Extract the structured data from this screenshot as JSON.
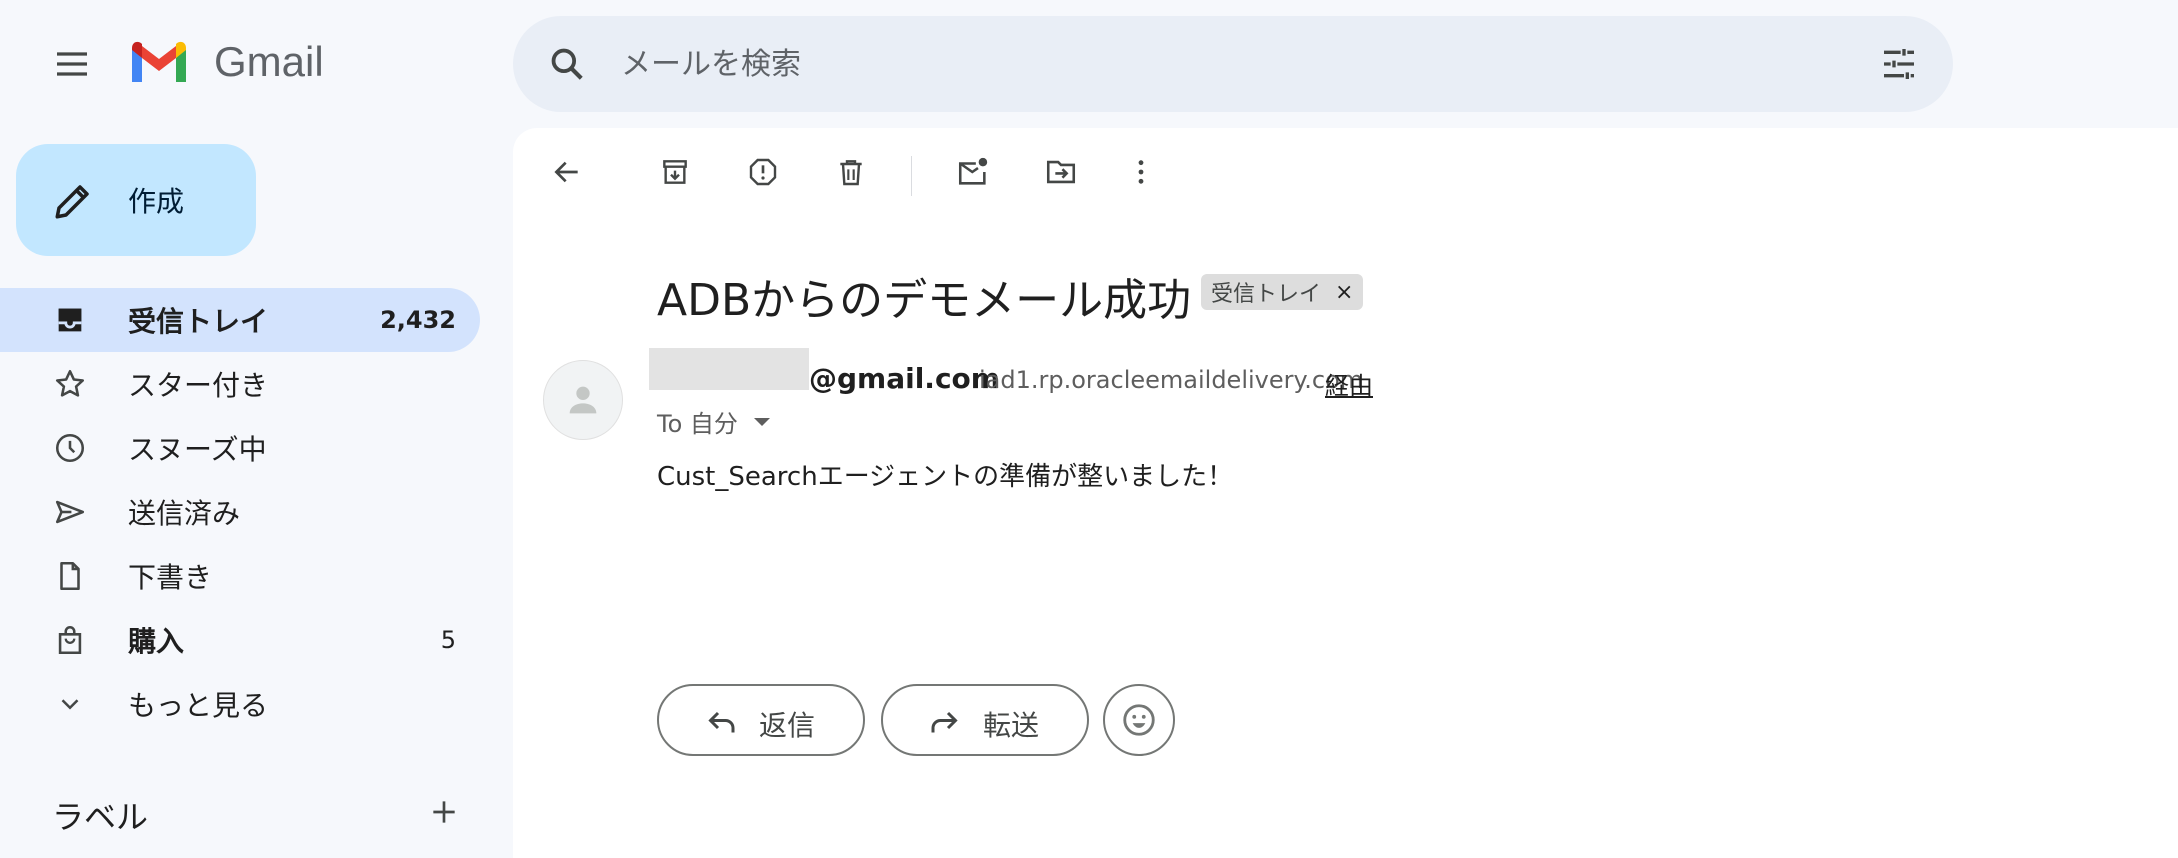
{
  "header": {
    "app_name": "Gmail",
    "search_placeholder": "メールを検索"
  },
  "compose": {
    "label": "作成"
  },
  "sidebar": {
    "items": [
      {
        "label": "受信トレイ",
        "count": "2,432",
        "active": true,
        "bold": true,
        "icon": "inbox-icon"
      },
      {
        "label": "スター付き",
        "count": "",
        "icon": "star-icon"
      },
      {
        "label": "スヌーズ中",
        "count": "",
        "icon": "clock-icon"
      },
      {
        "label": "送信済み",
        "count": "",
        "icon": "send-icon"
      },
      {
        "label": "下書き",
        "count": "",
        "icon": "file-icon"
      },
      {
        "label": "購入",
        "count": "5",
        "bold": true,
        "icon": "shopping-bag-icon"
      },
      {
        "label": "もっと見る",
        "count": "",
        "icon": "chevron-down-icon"
      }
    ],
    "labels_heading": "ラベル"
  },
  "toolbar": {
    "icons": [
      "back-icon",
      "archive-icon",
      "report-spam-icon",
      "delete-icon",
      "mark-unread-icon",
      "move-to-icon",
      "more-vert-icon"
    ]
  },
  "message": {
    "subject": "ADBからのデモメール成功",
    "label_chip": "受信トレイ",
    "label_chip_close": "×",
    "sender_email": "@gmail.com",
    "via_domain": "iad1.rp.oracleemaildelivery.com",
    "via_text": "経由",
    "to_text": "To 自分",
    "body": "Cust_Searchエージェントの準備が整いました！"
  },
  "actions": {
    "reply_label": "返信",
    "forward_label": "転送"
  },
  "colors": {
    "background": "#f6f8fc",
    "compose_bg": "#c2e7ff",
    "active_nav_bg": "#d3e3fd",
    "search_bg": "#e9eef6"
  }
}
